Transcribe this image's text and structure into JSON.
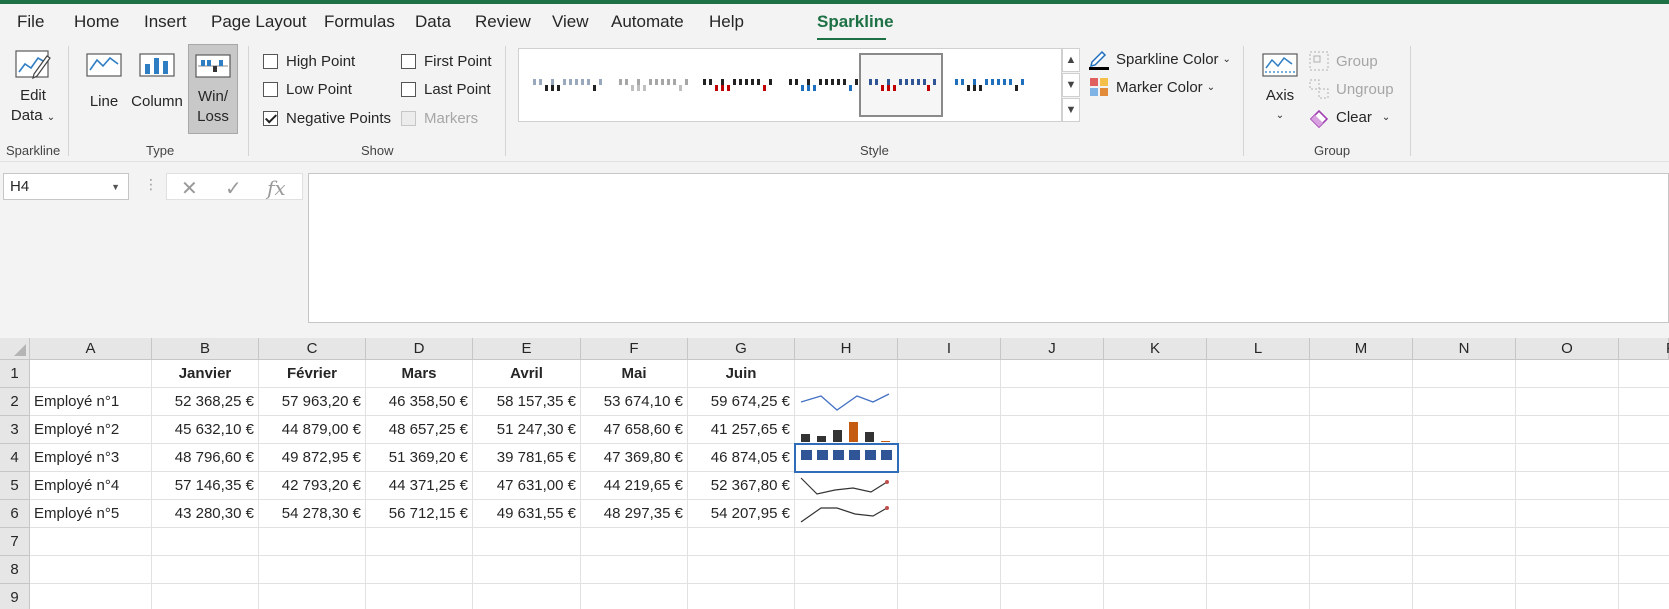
{
  "menu": {
    "tabs": [
      {
        "label": "File"
      },
      {
        "label": "Home"
      },
      {
        "label": "Insert"
      },
      {
        "label": "Page Layout"
      },
      {
        "label": "Formulas"
      },
      {
        "label": "Data"
      },
      {
        "label": "Review"
      },
      {
        "label": "View"
      },
      {
        "label": "Automate"
      },
      {
        "label": "Help"
      },
      {
        "label": "Sparkline"
      }
    ],
    "active_tab": "Sparkline"
  },
  "ribbon": {
    "sparkline_group": {
      "label": "Sparkline",
      "edit_data_line1": "Edit",
      "edit_data_line2": "Data",
      "edit_data_icon": "edit-data-icon"
    },
    "type_group": {
      "label": "Type",
      "line_label": "Line",
      "column_label": "Column",
      "winloss_line1": "Win/",
      "winloss_line2": "Loss",
      "selected": "Win/Loss"
    },
    "show_group": {
      "label": "Show",
      "options": [
        {
          "label": "High Point",
          "checked": false,
          "enabled": true
        },
        {
          "label": "Low Point",
          "checked": false,
          "enabled": true
        },
        {
          "label": "Negative Points",
          "checked": true,
          "enabled": true
        },
        {
          "label": "First Point",
          "checked": false,
          "enabled": true
        },
        {
          "label": "Last Point",
          "checked": false,
          "enabled": true
        },
        {
          "label": "Markers",
          "checked": false,
          "enabled": false
        }
      ]
    },
    "style_group": {
      "label": "Style",
      "selected_index": 4,
      "sparkline_color_label": "Sparkline Color",
      "marker_color_label": "Marker Color"
    },
    "group_group": {
      "label": "Group",
      "axis_label": "Axis",
      "group_label": "Group",
      "ungroup_label": "Ungroup",
      "clear_label": "Clear"
    }
  },
  "formula_bar": {
    "name_box": "H4",
    "formula": ""
  },
  "sheet": {
    "columns": [
      "A",
      "B",
      "C",
      "D",
      "E",
      "F",
      "G",
      "H",
      "I",
      "J",
      "K",
      "L",
      "M",
      "N",
      "O",
      "P"
    ],
    "rows": [
      "1",
      "2",
      "3",
      "4",
      "5",
      "6",
      "7",
      "8",
      "9"
    ],
    "headers": [
      "",
      "Janvier",
      "Février",
      "Mars",
      "Avril",
      "Mai",
      "Juin"
    ],
    "data": [
      [
        "Employé n°1",
        "52 368,25 €",
        "57 963,20 €",
        "46 358,50 €",
        "58 157,35 €",
        "53 674,10 €",
        "59 674,25 €"
      ],
      [
        "Employé n°2",
        "45 632,10 €",
        "44 879,00 €",
        "48 657,25 €",
        "51 247,30 €",
        "47 658,60 €",
        "41 257,65 €"
      ],
      [
        "Employé n°3",
        "48 796,60 €",
        "49 872,95 €",
        "51 369,20 €",
        "39 781,65 €",
        "47 369,80 €",
        "46 874,05 €"
      ],
      [
        "Employé n°4",
        "57 146,35 €",
        "42 793,20 €",
        "44 371,25 €",
        "47 631,00 €",
        "44 219,65 €",
        "52 367,80 €"
      ],
      [
        "Employé n°5",
        "43 280,30 €",
        "54 278,30 €",
        "56 712,15 €",
        "49 631,55 €",
        "48 297,35 €",
        "54 207,95 €"
      ]
    ],
    "sparklines": [
      {
        "row": 2,
        "type": "line",
        "color": "#4472c4"
      },
      {
        "row": 3,
        "type": "column",
        "color": "#333333",
        "highlight_color": "#c55a11"
      },
      {
        "row": 4,
        "type": "win-loss",
        "color": "#2f5597"
      },
      {
        "row": 5,
        "type": "line",
        "color": "#333333",
        "marker_color": "#c0504d"
      },
      {
        "row": 6,
        "type": "line",
        "color": "#333333",
        "marker_color": "#c0504d"
      }
    ],
    "selected_cell": "H4"
  },
  "colors": {
    "accent_green": "#1e7145",
    "selection_blue": "#2f6db8"
  }
}
